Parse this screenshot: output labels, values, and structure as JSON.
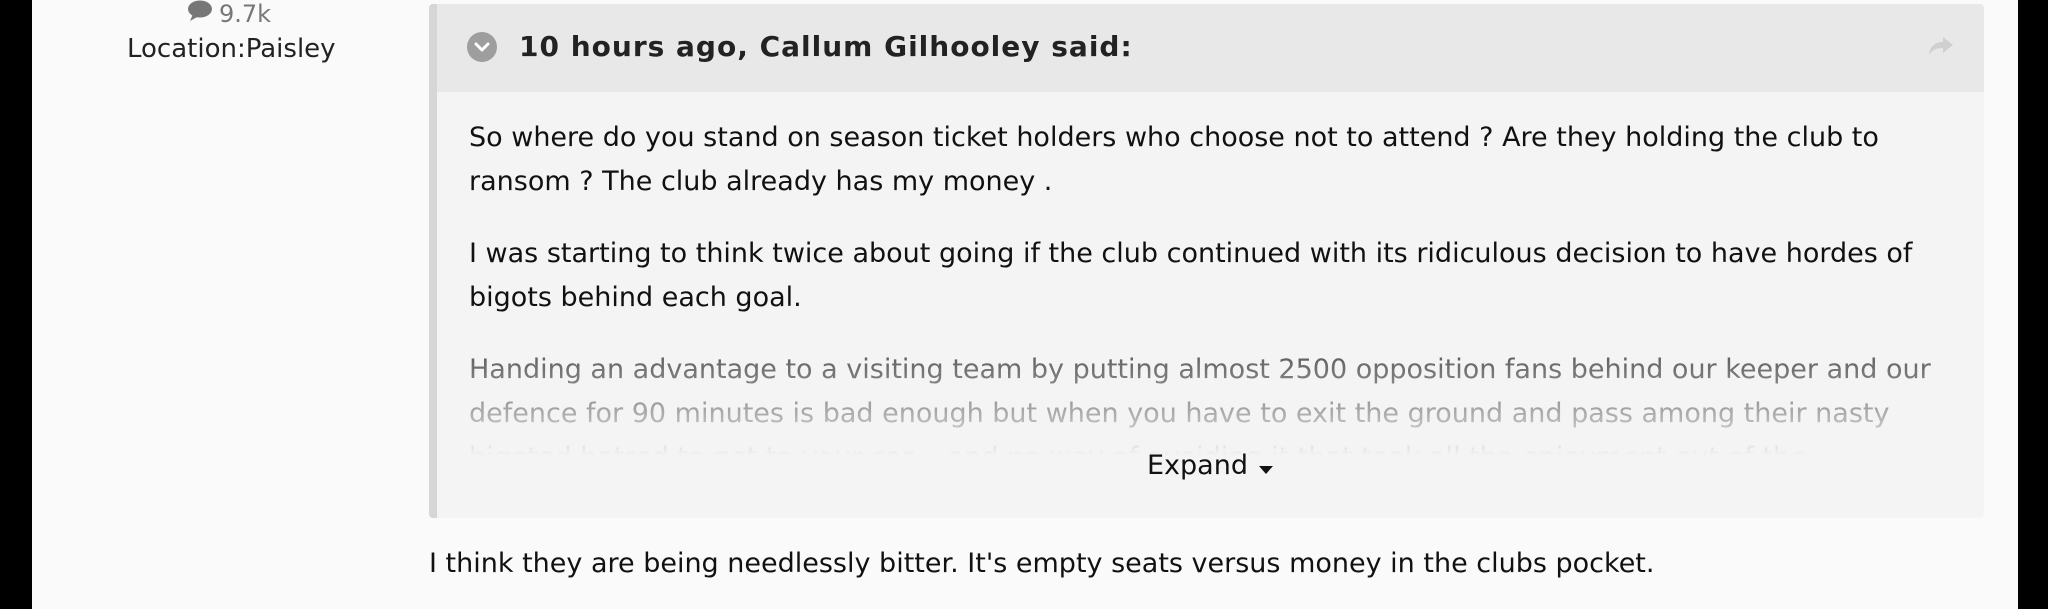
{
  "author": {
    "post_count": "9.7k",
    "location": "Location:Paisley",
    "post_count_icon": "speech-bubble-icon"
  },
  "quote": {
    "header": "10 hours ago, Callum Gilhooley said:",
    "collapse_icon": "chevron-down-circle-icon",
    "share_icon": "share-arrow-icon",
    "paragraphs": [
      "So where do you stand on season ticket holders who choose not to attend ?  Are they holding the club to ransom ? The club already has my money .",
      "I was starting to think twice about going if the club continued with its ridiculous decision to have hordes of bigots behind each goal."
    ],
    "faded_paragraph": "Handing an advantage to a visiting team by putting almost 2500 opposition fans behind our keeper and our defence for 90 minutes is bad enough but when you have to exit the ground and pass among their nasty bigoted hatred to get to your car .. and no way of avoiding it that took all the enjoyment out of the",
    "expand_label": "Expand"
  },
  "reply": {
    "text": "I think they are being needlessly bitter. It's empty seats versus money in the clubs pocket."
  }
}
